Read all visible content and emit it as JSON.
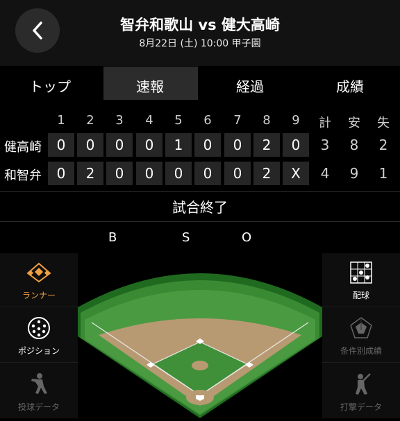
{
  "header": {
    "title": "智弁和歌山 vs 健大高崎",
    "subtitle": "8月22日 (土) 10:00 甲子園"
  },
  "tabs": [
    {
      "label": "トップ",
      "active": false
    },
    {
      "label": "速報",
      "active": true
    },
    {
      "label": "経過",
      "active": false
    },
    {
      "label": "成績",
      "active": false
    }
  ],
  "scoreboard": {
    "innings": [
      "1",
      "2",
      "3",
      "4",
      "5",
      "6",
      "7",
      "8",
      "9"
    ],
    "totals_headers": [
      "計",
      "安",
      "失"
    ],
    "rows": [
      {
        "team": "健高崎",
        "innings": [
          "0",
          "0",
          "0",
          "0",
          "1",
          "0",
          "0",
          "2",
          "0"
        ],
        "totals": [
          "3",
          "8",
          "2"
        ]
      },
      {
        "team": "和智弁",
        "innings": [
          "0",
          "2",
          "0",
          "0",
          "0",
          "0",
          "0",
          "2",
          "X"
        ],
        "totals": [
          "4",
          "9",
          "1"
        ]
      }
    ]
  },
  "status": "試合終了",
  "count": {
    "b": "B",
    "s": "S",
    "o": "O"
  },
  "left_panel": [
    {
      "label": "ランナー",
      "icon": "diamond-icon",
      "color": "#f0a040"
    },
    {
      "label": "ポジション",
      "icon": "positions-icon",
      "color": "#ffffff"
    },
    {
      "label": "投球データ",
      "icon": "pitcher-icon",
      "color": "#666666"
    }
  ],
  "right_panel": [
    {
      "label": "配球",
      "icon": "strike-zone-icon",
      "color": "#ffffff"
    },
    {
      "label": "条件別成績",
      "icon": "pentagon-chart-icon",
      "color": "#666666"
    },
    {
      "label": "打撃データ",
      "icon": "batter-icon",
      "color": "#666666"
    }
  ]
}
